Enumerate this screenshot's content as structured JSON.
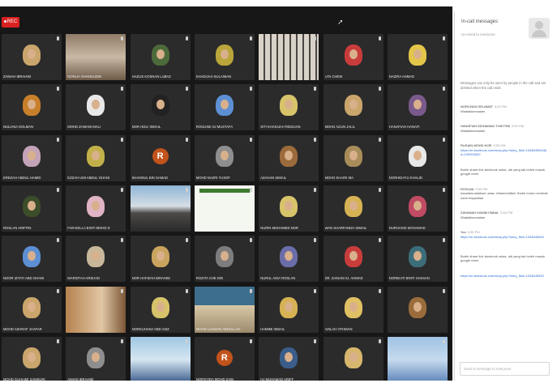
{
  "recording": {
    "label": "REC"
  },
  "participants": [
    {
      "name": "Zaniah Ibrahim",
      "kind": "avatar",
      "color": "#caa56c"
    },
    {
      "name": "Norlia Shamsudin",
      "kind": "scene",
      "scene": "books"
    },
    {
      "name": "Hazlie Kosnan Lubaz",
      "kind": "avatar",
      "color": "#4d6a3a"
    },
    {
      "name": "Khadijah Sulaiman",
      "kind": "avatar",
      "color": "#b9a53b"
    },
    {
      "name": "",
      "kind": "scene",
      "scene": "shelf"
    },
    {
      "name": "Lyn Chew",
      "kind": "avatar",
      "color": "#c93c3c"
    },
    {
      "name": "Nazira Ahmad",
      "kind": "avatar",
      "color": "#e3c54a"
    },
    {
      "name": "Nuliana Dolman",
      "kind": "avatar",
      "color": "#c77f2a"
    },
    {
      "name": "Mohd Zamani Mali",
      "kind": "avatar",
      "color": "#e8e8e8"
    },
    {
      "name": "Nor Hizli Ismail",
      "kind": "avatar",
      "color": "#222"
    },
    {
      "name": "Rosline Hj Mustafa",
      "kind": "avatar",
      "color": "#5d8fd3"
    },
    {
      "name": "Siti Khadijah Ridzuan",
      "kind": "avatar",
      "color": "#d7c36a"
    },
    {
      "name": "Mohd Azlin Jalil",
      "kind": "avatar",
      "color": "#caa56c"
    },
    {
      "name": "Hanafiah Hanafi",
      "kind": "avatar",
      "color": "#7a5a8c"
    },
    {
      "name": "Erezah Abdul Hamid",
      "kind": "avatar",
      "color": "#c3a3b8"
    },
    {
      "name": "Ezzah Umi Abdul Ghani",
      "kind": "avatar",
      "color": "#c2b04a"
    },
    {
      "name": "Shamsul Bin Samad",
      "kind": "initial",
      "initial": "R"
    },
    {
      "name": "Mohd Nazri Yusof",
      "kind": "avatar",
      "color": "#8e8e8e"
    },
    {
      "name": "Azahan Ismail",
      "kind": "avatar",
      "color": "#9c6b3b"
    },
    {
      "name": "Mohd Khairi Ma",
      "kind": "avatar",
      "color": "#a88d5a"
    },
    {
      "name": "Norhidayu Khalid",
      "kind": "avatar",
      "color": "#e8e8e8"
    },
    {
      "name": "Roslan Ariffin",
      "kind": "avatar",
      "color": "#3c4d2a"
    },
    {
      "name": "Faradilla Binti Mohd D",
      "kind": "avatar",
      "color": "#e0b4c4"
    },
    {
      "name": "",
      "kind": "scene",
      "scene": "kaaba"
    },
    {
      "name": "",
      "kind": "scene",
      "scene": "slide"
    },
    {
      "name": "Nurin Mohamed Nor",
      "kind": "avatar",
      "color": "#d7c36a"
    },
    {
      "name": "Wan Sharfaniza Ismail",
      "kind": "avatar",
      "color": "#d6b254"
    },
    {
      "name": "Nurhanis Mohamad",
      "kind": "avatar",
      "color": "#c04b63"
    },
    {
      "name": "Noor Izyati Abd Ghani",
      "kind": "avatar",
      "color": "#5d8fd3"
    },
    {
      "name": "Marsitah Arshad",
      "kind": "avatar",
      "color": "#c8b79a"
    },
    {
      "name": "Nor Hafizah Ibrahim",
      "kind": "avatar",
      "color": "#c9a45e"
    },
    {
      "name": "Rozita Che Din",
      "kind": "avatar",
      "color": "#7d7d7d"
    },
    {
      "name": "Nurul Aida Roslan",
      "kind": "avatar",
      "color": "#6a6da8"
    },
    {
      "name": "Dr. Zainab Hj. Ahmad",
      "kind": "avatar",
      "color": "#c93c3c"
    },
    {
      "name": "Norbaiti Binti Hassan",
      "kind": "avatar",
      "color": "#3c6e7a"
    },
    {
      "name": "Mohd Ashraf Jaafar",
      "kind": "avatar",
      "color": "#caa56c"
    },
    {
      "name": "",
      "kind": "scene",
      "scene": "wood"
    },
    {
      "name": "Norsuhana Abd Aziz",
      "kind": "avatar",
      "color": "#d7c36a"
    },
    {
      "name": "Mohd Lukman Abdullah",
      "kind": "scene",
      "scene": "classroom"
    },
    {
      "name": "Hamimi Ismail",
      "kind": "avatar",
      "color": "#d6b254"
    },
    {
      "name": "Azilah Othman",
      "kind": "avatar",
      "color": "#e0c064"
    },
    {
      "name": "",
      "kind": "avatar",
      "color": "#9b6c3b"
    },
    {
      "name": "Mohd Suhaimi Samsuri",
      "kind": "avatar",
      "color": "#caa56c"
    },
    {
      "name": "Aiman Ibrahim",
      "kind": "avatar",
      "color": "#8e8e8e"
    },
    {
      "name": "",
      "kind": "scene",
      "scene": "outdoor"
    },
    {
      "name": "Norsyida Mohd Zain",
      "kind": "initial",
      "initial": "R"
    },
    {
      "name": "Hj Muhamad Ariff",
      "kind": "avatar",
      "color": "#3b5d8a"
    },
    {
      "name": "",
      "kind": "avatar",
      "color": "#d7b66d"
    },
    {
      "name": "",
      "kind": "scene",
      "scene": "blue"
    }
  ],
  "chat": {
    "title": "In-call messages",
    "subtitle": "Un-send to everyone",
    "notice": "Messages can only be seen by people in the call and are deleted when the call ends",
    "messages": [
      {
        "from": "NORLINDA SELAMAT",
        "time": "5:52 PM",
        "text": "Waalaikumsalam"
      },
      {
        "from": "HANAFIAH MOHAMAD THAYYIBI",
        "time": "5:52 PM",
        "text": "Waalaikumsalam"
      },
      {
        "from": "RUSAIN MOHD NOR",
        "time": "5:53 PM",
        "text": "",
        "link": "https://m.facebook.com/story.php?story_fbid=1034845543&id=100003452"
      },
      {
        "from": "",
        "time": "",
        "text": "Boleh share link facebook ustaz, utk yang tak boleh masuk google meet"
      },
      {
        "from": "ROSLAN",
        "time": "5:53 PM",
        "text": "Assalamualaikum ustaz. Alhamdulillah. Boleh tonton kembali nanti InsyaAllah"
      },
      {
        "from": "ZAHANAH HANIM ISMAIL",
        "time": "5:54 PM",
        "text": "Waalaikumsalam"
      },
      {
        "from": "You",
        "time": "5:55 PM",
        "text": "",
        "link": "https://m.facebook.com/story.php?story_fbid=1034845543"
      },
      {
        "from": "",
        "time": "",
        "text": "Boleh share link facebook ustaz, utk yang tak boleh masuk google meet"
      },
      {
        "from": "",
        "time": "",
        "text": "",
        "link": "https://m.facebook.com/story.php?story_fbid=1034845543"
      }
    ],
    "input_placeholder": "Send a message to everyone"
  }
}
